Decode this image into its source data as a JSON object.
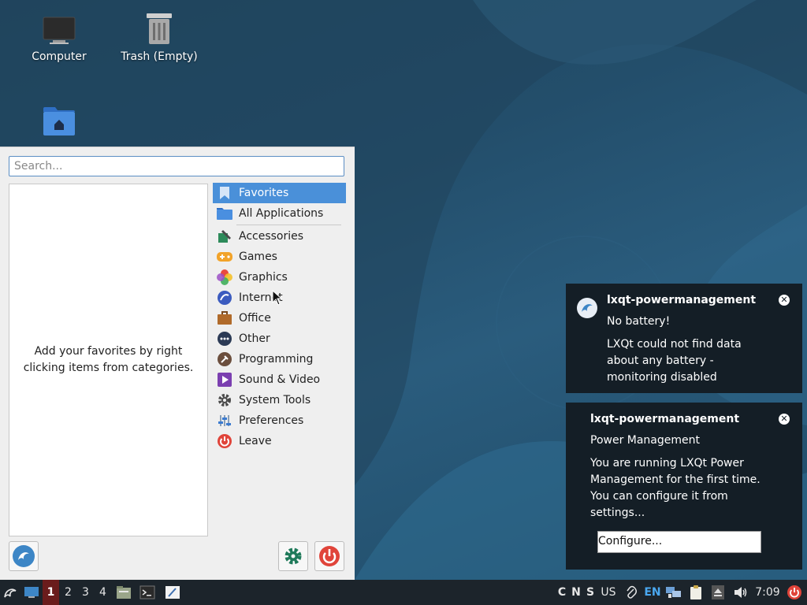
{
  "desktop": {
    "icons": [
      {
        "label": "Computer",
        "icon": "monitor-icon"
      },
      {
        "label": "Trash (Empty)",
        "icon": "trash-icon"
      },
      {
        "label": "",
        "icon": "home-folder-icon"
      }
    ]
  },
  "menu": {
    "search_placeholder": "Search...",
    "favorites_hint": "Add your favorites by right clicking items from categories.",
    "categories": [
      {
        "label": "Favorites",
        "icon": "bookmark-icon"
      },
      {
        "label": "All Applications",
        "icon": "folder-icon"
      },
      {
        "label": "Accessories",
        "icon": "accessories-icon"
      },
      {
        "label": "Games",
        "icon": "gamepad-icon"
      },
      {
        "label": "Graphics",
        "icon": "graphics-icon"
      },
      {
        "label": "Internet",
        "icon": "globe-icon"
      },
      {
        "label": "Office",
        "icon": "briefcase-icon"
      },
      {
        "label": "Other",
        "icon": "dots-icon"
      },
      {
        "label": "Programming",
        "icon": "hammer-icon"
      },
      {
        "label": "Sound & Video",
        "icon": "media-icon"
      },
      {
        "label": "System Tools",
        "icon": "gear-icon"
      },
      {
        "label": "Preferences",
        "icon": "sliders-icon"
      },
      {
        "label": "Leave",
        "icon": "power-icon"
      }
    ],
    "selected_category": "Favorites"
  },
  "notifications": [
    {
      "app": "lxqt-powermanagement",
      "title": "No battery!",
      "body": "LXQt could not find data about any battery - monitoring disabled"
    },
    {
      "app": "lxqt-powermanagement",
      "title": "Power Management",
      "body": "You are running LXQt Power Management for the first time. You can configure it from settings...",
      "action": "Configure..."
    }
  ],
  "taskbar": {
    "desktops": [
      "1",
      "2",
      "3",
      "4"
    ],
    "active_desktop": "1",
    "indicators": [
      "C",
      "N",
      "S"
    ],
    "layout": "US",
    "lang": "EN",
    "clock": "7:09"
  },
  "colors": {
    "accent": "#4a90d9",
    "taskbar": "#1c242b",
    "active_desktop": "#6a1c1c",
    "notification_bg": "#141e26"
  }
}
